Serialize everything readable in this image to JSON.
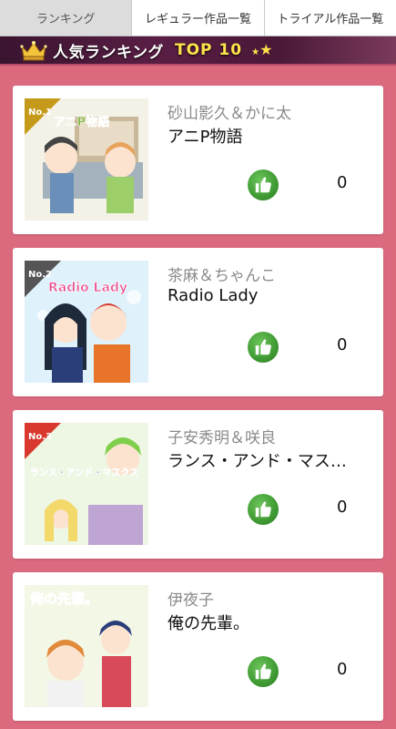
{
  "tabs": [
    {
      "label": "ランキング",
      "active": true
    },
    {
      "label": "レギュラー作品一覧",
      "active": false
    },
    {
      "label": "トライアル作品一覧",
      "active": false
    }
  ],
  "banner": {
    "text": "人気ランキング",
    "top": "TOP 10"
  },
  "items": [
    {
      "rank_badge": "No.1",
      "cover_title": "アニP物語",
      "author": "砂山影久＆かに太",
      "title": "アニP物語",
      "likes": "0",
      "bg": "#f4f1e6",
      "accent": "#7fb53a"
    },
    {
      "rank_badge": "No.2",
      "cover_title": "Radio Lady",
      "author": "茶麻＆ちゃんこ",
      "title": "Radio Lady",
      "likes": "0",
      "bg": "#dff1fb",
      "accent": "#e84a8a"
    },
    {
      "rank_badge": "No.3",
      "cover_title": "ランス・アンド・マスクス",
      "author": "子安秀明＆咲良",
      "title": "ランス・アンド・マス…",
      "likes": "0",
      "bg": "#eef6e4",
      "accent": "#2a3a8a"
    },
    {
      "rank_badge": "",
      "cover_title": "俺の先輩。",
      "author": "伊夜子",
      "title": "俺の先輩。",
      "likes": "0",
      "bg": "#f3f7e6",
      "accent": "#3a8ad0"
    }
  ],
  "colors": {
    "page_bg": "#dc6a7f",
    "like_green": "#3f9a33",
    "banner_gold": "#ffe34a"
  },
  "icons": {
    "like": "thumbs-up-icon",
    "crown": "crown-icon"
  }
}
